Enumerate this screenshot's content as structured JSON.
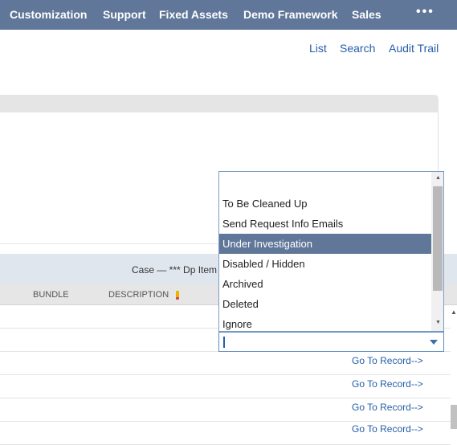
{
  "top_nav": {
    "items": [
      "Customization",
      "Support",
      "Fixed Assets",
      "Demo Framework",
      "Sales"
    ],
    "more_label": "•••"
  },
  "record_links": {
    "list": "List",
    "search": "Search",
    "audit_trail": "Audit Trail"
  },
  "sublist": {
    "title": "Case — *** Dp Item",
    "columns": {
      "bundle": "BUNDLE",
      "description": "DESCRIPTION"
    },
    "rows": [
      {
        "link": ""
      },
      {
        "link": ""
      },
      {
        "link": "Go To Record-->"
      },
      {
        "link": "Go To Record-->"
      },
      {
        "link": "Go To Record-->"
      },
      {
        "link": "Go To Record-->"
      }
    ]
  },
  "status_dropdown": {
    "options": [
      "",
      "To Be Cleaned Up",
      "Send Request Info Emails",
      "Under Investigation",
      "Disabled / Hidden",
      "Archived",
      "Deleted",
      "Ignore"
    ],
    "selected_option": "Under Investigation",
    "current_value": ""
  },
  "icons": {
    "more": "more-dots-icon",
    "pencil": "pencil-icon",
    "scroll_up": "scroll-up-arrow-icon",
    "scroll_down": "scroll-down-arrow-icon",
    "dropdown": "chevron-down-icon"
  },
  "colors": {
    "nav_bg": "#607799",
    "link": "#255ea8",
    "selected_bg": "#607799"
  }
}
